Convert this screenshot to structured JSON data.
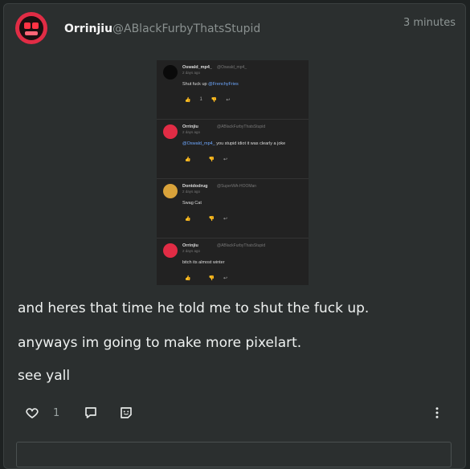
{
  "post": {
    "username": "Orrinjiu",
    "handle": "@ABlackFurbyThatsStupid",
    "timestamp": "3 minutes",
    "body": [
      "and heres that time he told me to shut the fuck up.",
      "anyways im going to make more pixelart.",
      "see yall"
    ],
    "like_count": "1"
  },
  "embedded_comments": [
    {
      "name": "Oswald_mp4_",
      "handle": "@Oswald_mp4_",
      "time": "2 days ago",
      "text_before": "Shut fuck up ",
      "mention": "@FrenchyFries",
      "text_after": "",
      "likes": "1",
      "avatar_color": "#0a0a0a"
    },
    {
      "name": "Orrinjiu",
      "handle": "@ABlackFurbyThatsStupid",
      "time": "2 days ago",
      "text_before": "",
      "mention": "@Oswald_mp4_",
      "text_after": " you stupid idiot it was clearly a joke",
      "likes": "",
      "avatar_color": "#e12c45"
    },
    {
      "name": "Dontdodrug",
      "handle": "@SuperWA-HOOMan",
      "time": "2 days ago",
      "text_before": "Swag Cat",
      "mention": "",
      "text_after": "",
      "likes": "",
      "avatar_color": "#d9a23a"
    },
    {
      "name": "Orrinjiu",
      "handle": "@ABlackFurbyThatsStupid",
      "time": "2 days ago",
      "text_before": "bitch its almost winter",
      "mention": "",
      "text_after": "",
      "likes": "",
      "avatar_color": "#e12c45"
    }
  ],
  "icons": {
    "like": "heart-icon",
    "comment": "comment-icon",
    "share": "sticker-icon",
    "more": "more-vertical-icon"
  },
  "colors": {
    "accent": "#e12c45",
    "mention": "#6ea8ff"
  }
}
